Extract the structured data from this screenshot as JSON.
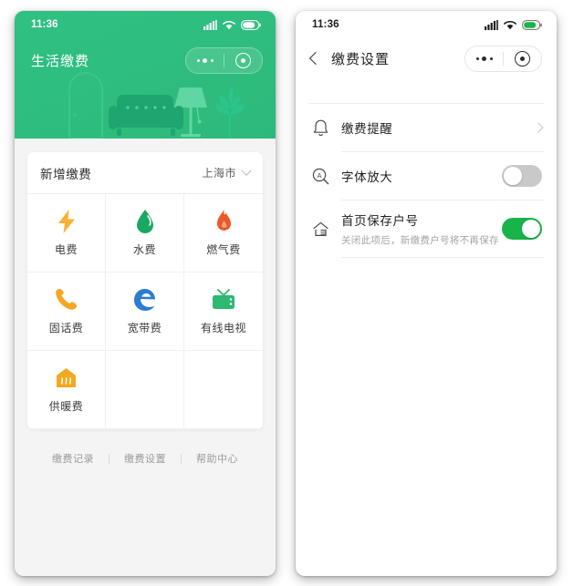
{
  "left_phone": {
    "status_bar": {
      "time": "11:36",
      "signal": "signal-bars-icon",
      "wifi": "wifi-icon",
      "battery": "battery-icon"
    },
    "hero": {
      "title": "生活缴费",
      "capsule": {
        "menu": "more-dots-icon",
        "target": "target-circle-icon"
      },
      "background_color": "#2ebd7e",
      "illustration": "living-room-silhouette"
    },
    "card": {
      "title": "新增缴费",
      "city": "上海市",
      "city_chevron": "chevron-down-icon",
      "items": [
        {
          "label": "电费",
          "icon": "lightning-bolt-icon",
          "color": "#f8b133"
        },
        {
          "label": "水费",
          "icon": "water-drop-icon",
          "color": "#19a862"
        },
        {
          "label": "燃气费",
          "icon": "flame-icon",
          "color": "#ea5a28"
        },
        {
          "label": "固话费",
          "icon": "telephone-icon",
          "color": "#f5a623"
        },
        {
          "label": "宽带费",
          "icon": "edge-browser-e-icon",
          "color": "#2b7cd3"
        },
        {
          "label": "有线电视",
          "icon": "television-icon",
          "color": "#2eb872"
        },
        {
          "label": "供暖费",
          "icon": "radiator-house-icon",
          "color": "#f3a81f"
        }
      ]
    },
    "footer_links": [
      "缴费记录",
      "缴费设置",
      "帮助中心"
    ]
  },
  "right_phone": {
    "status_bar": {
      "time": "11:36",
      "signal": "signal-bars-icon",
      "wifi": "wifi-icon",
      "battery": "battery-icon"
    },
    "navbar": {
      "back": "chevron-left-icon",
      "title": "缴费设置",
      "capsule": {
        "menu": "more-dots-icon",
        "target": "target-circle-icon"
      }
    },
    "settings": [
      {
        "icon": "bell-icon",
        "title": "缴费提醒",
        "subtitle": "",
        "control": "chevron",
        "toggle_on": false
      },
      {
        "icon": "font-size-magnifier-icon",
        "title": "字体放大",
        "subtitle": "",
        "control": "toggle",
        "toggle_on": false
      },
      {
        "icon": "home-icon",
        "title": "首页保存户号",
        "subtitle": "关闭此项后，新缴费户号将不再保存",
        "control": "toggle",
        "toggle_on": true
      }
    ],
    "toggle_on_color": "#18b449",
    "toggle_off_color": "#c9c9c9"
  }
}
